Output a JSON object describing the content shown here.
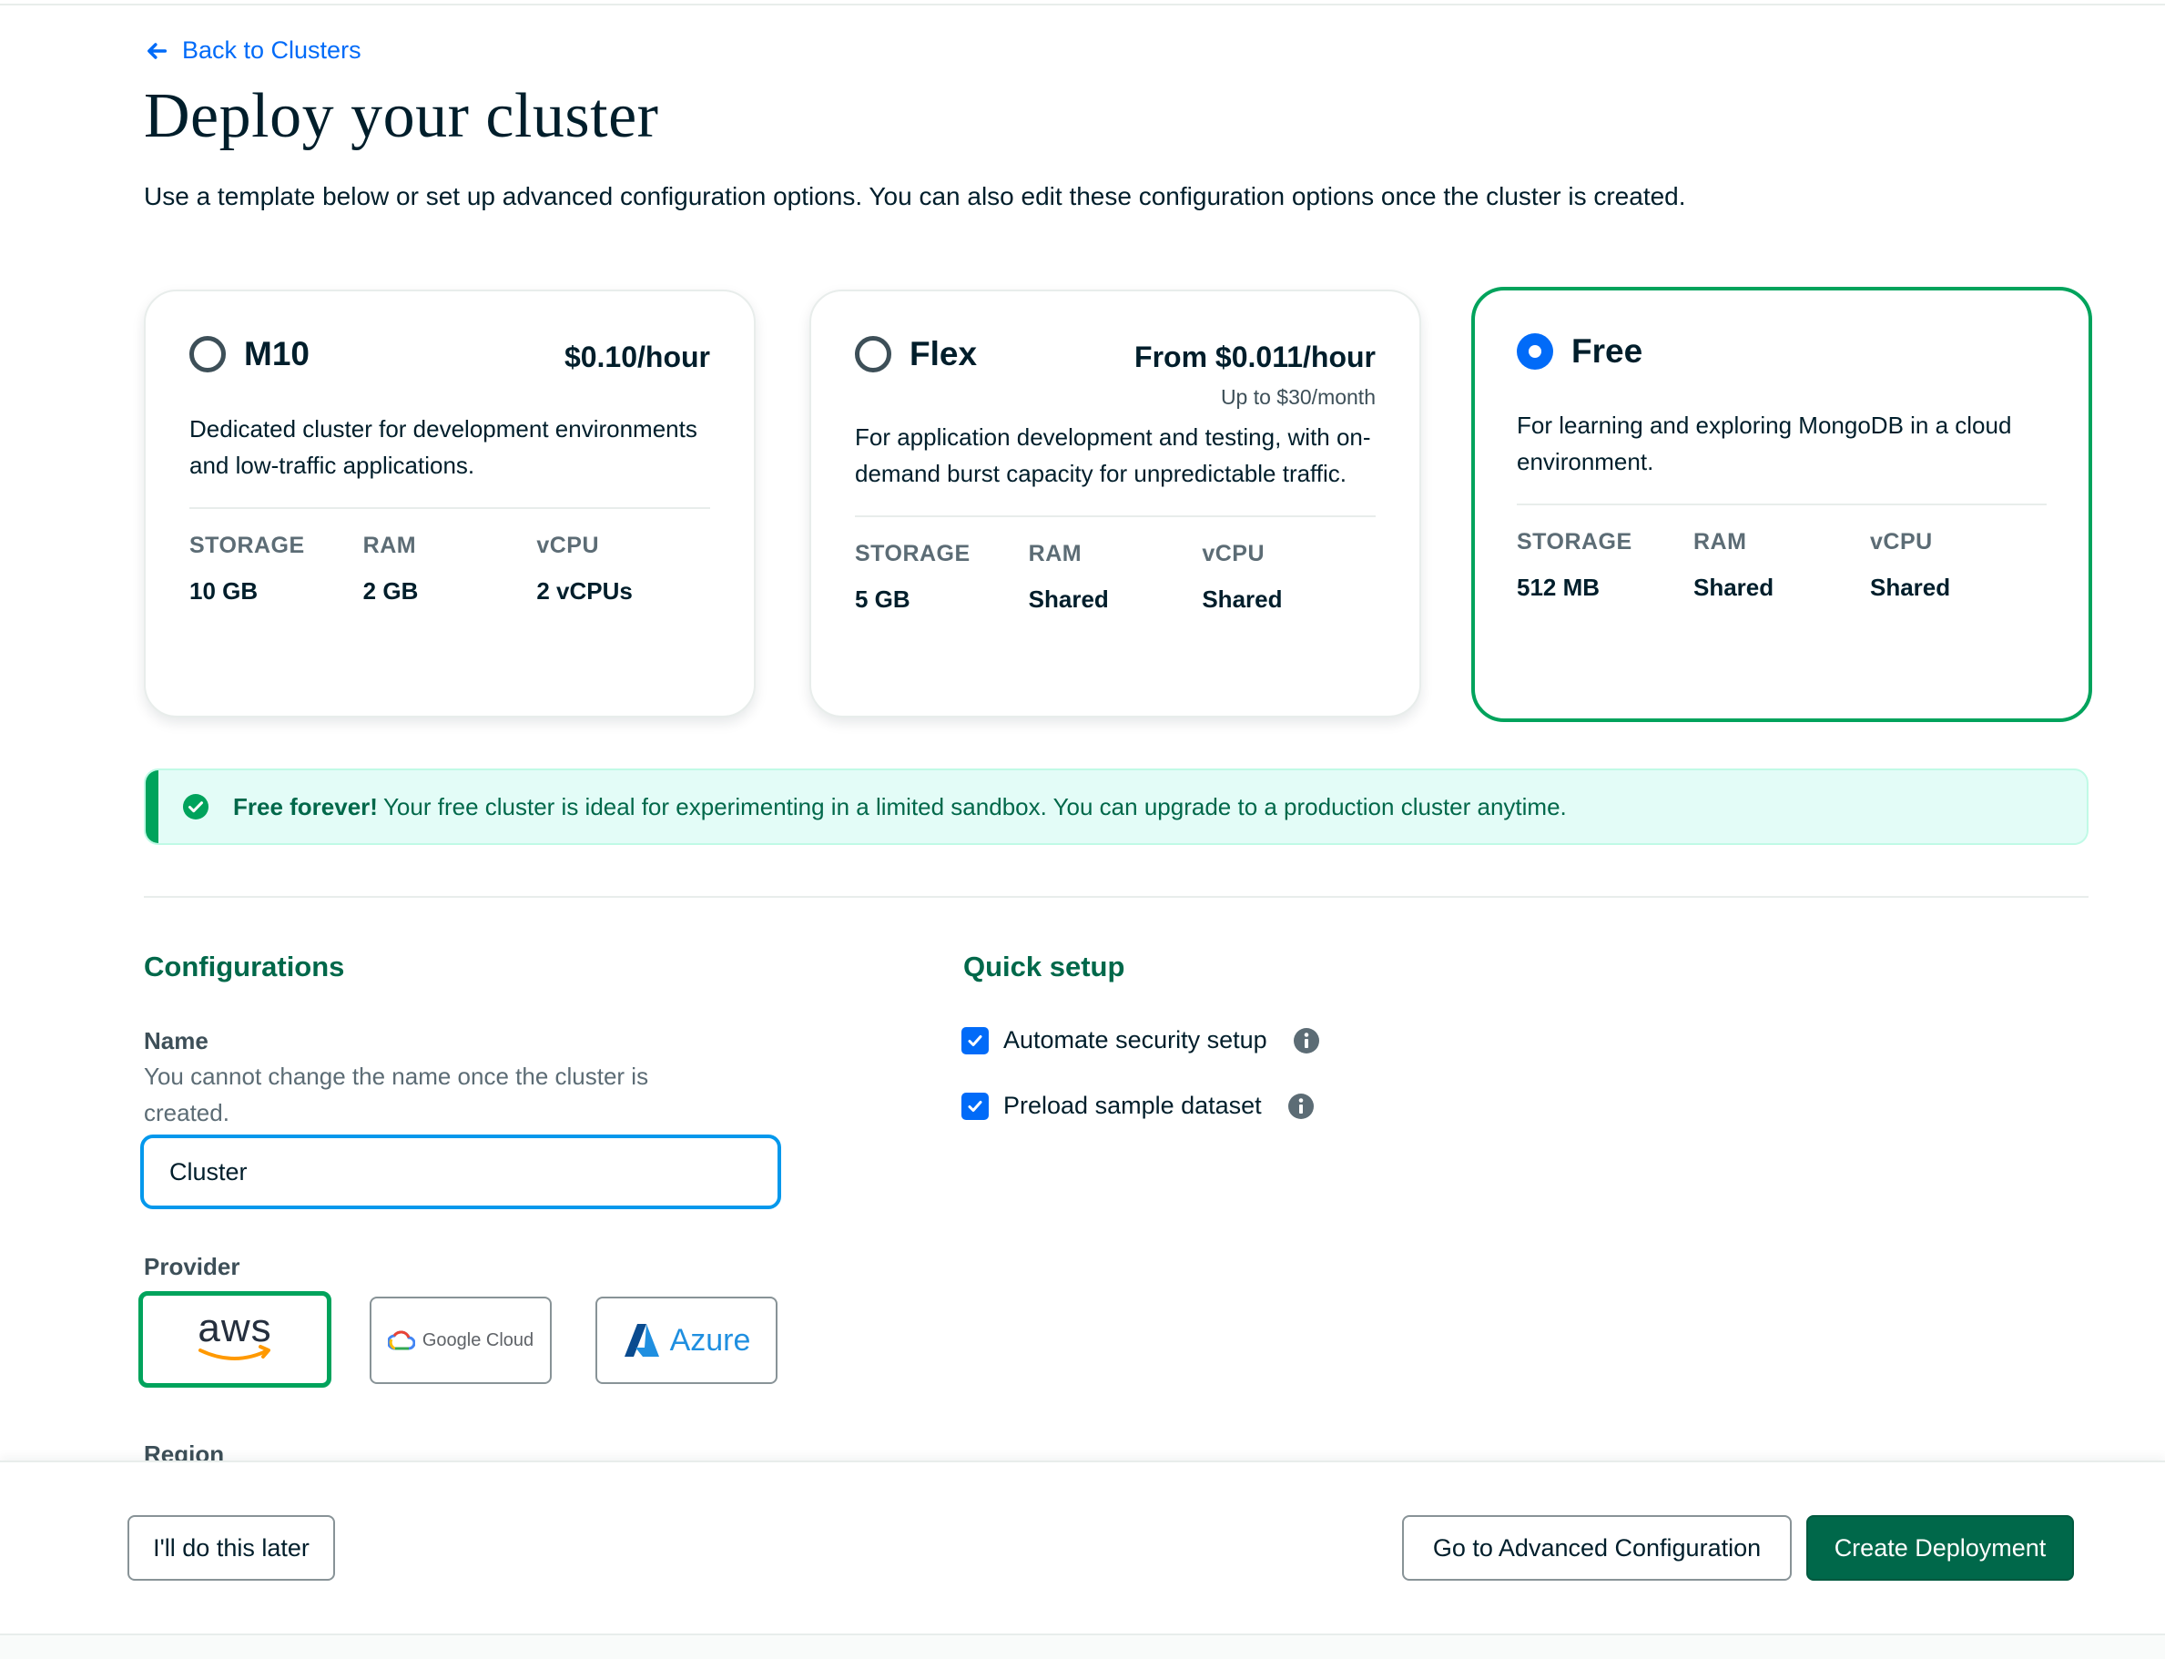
{
  "nav": {
    "back_label": "Back to Clusters"
  },
  "header": {
    "title": "Deploy your cluster",
    "subtitle": "Use a template below or set up advanced configuration options. You can also edit these configuration options once the cluster is created."
  },
  "tiers": [
    {
      "name": "M10",
      "price": "$0.10/hour",
      "price_sub": "",
      "selected": false,
      "description": "Dedicated cluster for development environments and low-traffic applications.",
      "specs": [
        {
          "label": "STORAGE",
          "value": "10 GB"
        },
        {
          "label": "RAM",
          "value": "2 GB"
        },
        {
          "label": "vCPU",
          "value": "2 vCPUs"
        }
      ]
    },
    {
      "name": "Flex",
      "price": "From $0.011/hour",
      "price_sub": "Up to $30/month",
      "selected": false,
      "description": "For application development and testing, with on-demand burst capacity for unpredictable traffic.",
      "specs": [
        {
          "label": "STORAGE",
          "value": "5 GB"
        },
        {
          "label": "RAM",
          "value": "Shared"
        },
        {
          "label": "vCPU",
          "value": "Shared"
        }
      ]
    },
    {
      "name": "Free",
      "price": "",
      "price_sub": "",
      "selected": true,
      "description": "For learning and exploring MongoDB in a cloud environment.",
      "specs": [
        {
          "label": "STORAGE",
          "value": "512 MB"
        },
        {
          "label": "RAM",
          "value": "Shared"
        },
        {
          "label": "vCPU",
          "value": "Shared"
        }
      ]
    }
  ],
  "banner": {
    "strong": "Free forever!",
    "text": "Your free cluster is ideal for experimenting in a limited sandbox. You can upgrade to a production cluster anytime."
  },
  "configurations": {
    "title": "Configurations",
    "name_label": "Name",
    "name_help": "You cannot change the name once the cluster is created.",
    "name_value": "Cluster",
    "provider_label": "Provider",
    "providers": [
      {
        "name": "aws",
        "selected": true
      },
      {
        "name": "Google Cloud",
        "selected": false
      },
      {
        "name": "Azure",
        "selected": false
      }
    ],
    "region_label": "Region"
  },
  "quick_setup": {
    "title": "Quick setup",
    "options": [
      {
        "label": "Automate security setup",
        "checked": true
      },
      {
        "label": "Preload sample dataset",
        "checked": true
      }
    ]
  },
  "footer": {
    "later_label": "I'll do this later",
    "advanced_label": "Go to Advanced Configuration",
    "create_label": "Create Deployment"
  },
  "colors": {
    "accent_blue": "#016bf8",
    "brand_green": "#00684a",
    "selected_border": "#00a35c",
    "banner_bg": "#e3fcf7"
  },
  "icons": [
    "arrow-left-icon",
    "check-circle-icon",
    "info-icon",
    "checkmark-icon",
    "aws-logo",
    "google-cloud-logo",
    "azure-logo"
  ]
}
